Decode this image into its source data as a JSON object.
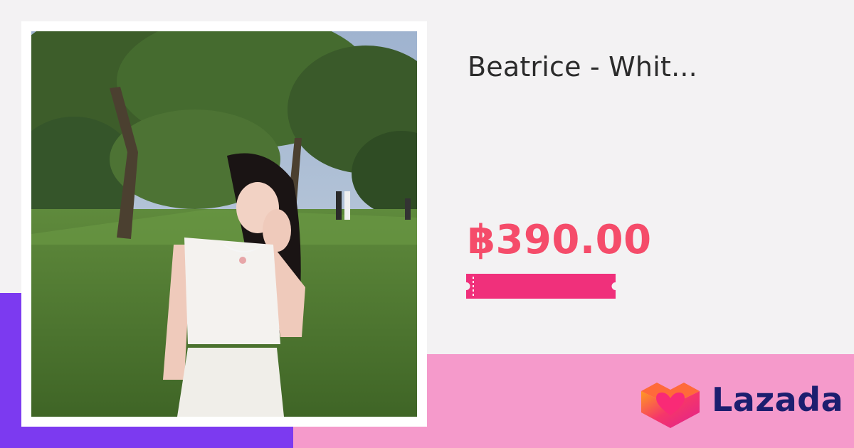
{
  "product": {
    "title": "Beatrice - Whit...",
    "price": "฿390.00",
    "image": "product-photo-woman-in-white-dress-in-park"
  },
  "brand": {
    "name": "Lazada",
    "logo_icon": "lazada-heart-box-icon"
  },
  "colors": {
    "background": "#f3f2f3",
    "purple_band": "#7c3af0",
    "pink_band": "#f59acb",
    "price": "#f54c6a",
    "voucher": "#f0307b",
    "brand_text": "#1c1e6f"
  }
}
